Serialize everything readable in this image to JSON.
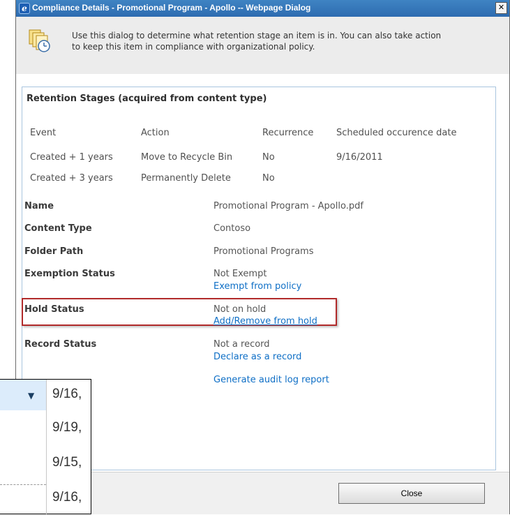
{
  "window": {
    "title": "Compliance Details - Promotional Program - Apollo -- Webpage Dialog",
    "close_glyph": "✕"
  },
  "intro": {
    "line1": "Use this dialog to determine what retention stage an item is in. You can also take action",
    "line2": "to keep this item in compliance with organizational policy."
  },
  "retention": {
    "heading": "Retention Stages (acquired from content type)",
    "columns": [
      "Event",
      "Action",
      "Recurrence",
      "Scheduled occurence date"
    ],
    "rows": [
      [
        "Created + 1 years",
        "Move to Recycle Bin",
        "No",
        "9/16/2011"
      ],
      [
        "Created + 3 years",
        "Permanently Delete",
        "No",
        ""
      ]
    ]
  },
  "properties": {
    "name_label": "Name",
    "name_value": "Promotional Program - Apollo.pdf",
    "content_type_label": "Content Type",
    "content_type_value": "Contoso",
    "folder_path_label": "Folder Path",
    "folder_path_value": "Promotional Programs",
    "exemption_label": "Exemption Status",
    "exemption_value": "Not Exempt",
    "exemption_link": "Exempt from policy",
    "hold_label": "Hold Status",
    "hold_value": "Not on hold",
    "hold_link": "Add/Remove from hold",
    "record_label": "Record Status",
    "record_value": "Not a record",
    "record_link": "Declare as a record",
    "audit_link": "Generate audit log report"
  },
  "footer": {
    "close_label": "Close"
  },
  "inset": {
    "dates": [
      "9/16,",
      "9/19,",
      "9/15,",
      "9/16,"
    ],
    "filter_icon": "dropdown-arrow-icon"
  },
  "colors": {
    "titlebar": "#2d6bb0",
    "link": "#0f6fc6",
    "highlight_box": "#b12a2a",
    "panel_border": "#a9c5de"
  }
}
